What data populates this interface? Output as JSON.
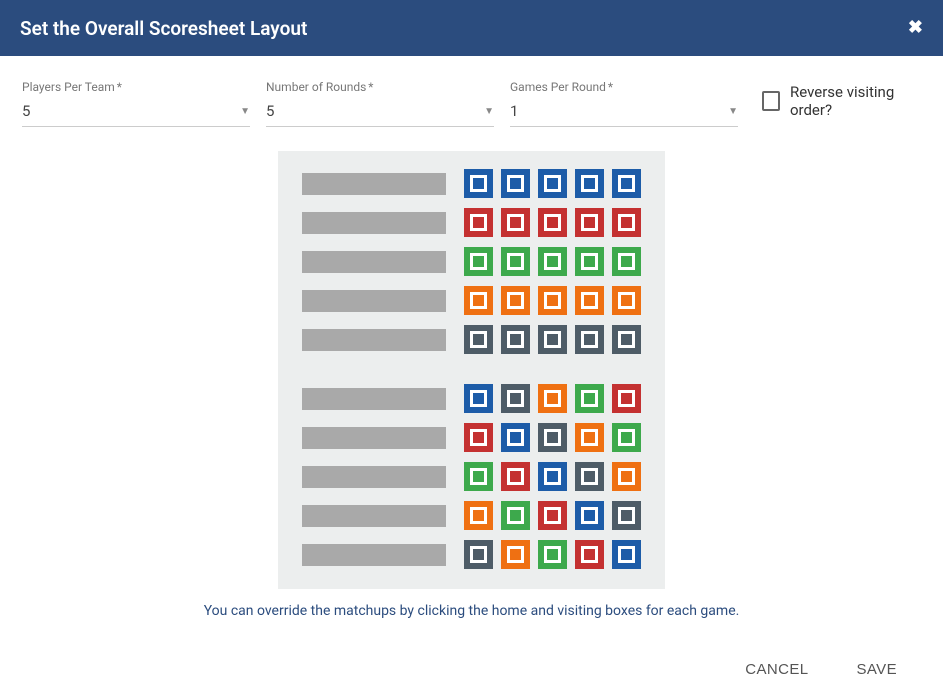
{
  "dialog": {
    "title": "Set the Overall Scoresheet Layout"
  },
  "fields": {
    "players": {
      "label": "Players Per Team",
      "value": "5"
    },
    "rounds": {
      "label": "Number of Rounds",
      "value": "5"
    },
    "games": {
      "label": "Games Per Round",
      "value": "1"
    },
    "reverse": {
      "label": "Reverse visiting order?",
      "checked": false
    }
  },
  "colors": {
    "blue": "#1d5ca8",
    "red": "#c43131",
    "green": "#3da94c",
    "orange": "#ef7012",
    "slate": "#4e5c67"
  },
  "preview": {
    "sections": [
      {
        "rows": [
          [
            "blue",
            "blue",
            "blue",
            "blue",
            "blue"
          ],
          [
            "red",
            "red",
            "red",
            "red",
            "red"
          ],
          [
            "green",
            "green",
            "green",
            "green",
            "green"
          ],
          [
            "orange",
            "orange",
            "orange",
            "orange",
            "orange"
          ],
          [
            "slate",
            "slate",
            "slate",
            "slate",
            "slate"
          ]
        ]
      },
      {
        "rows": [
          [
            "blue",
            "slate",
            "orange",
            "green",
            "red"
          ],
          [
            "red",
            "blue",
            "slate",
            "orange",
            "green"
          ],
          [
            "green",
            "red",
            "blue",
            "slate",
            "orange"
          ],
          [
            "orange",
            "green",
            "red",
            "blue",
            "slate"
          ],
          [
            "slate",
            "orange",
            "green",
            "red",
            "blue"
          ]
        ]
      }
    ]
  },
  "hint": "You can override the matchups by clicking the home and visiting boxes for each game.",
  "actions": {
    "cancel": "CANCEL",
    "save": "SAVE"
  },
  "required_marker": "*"
}
